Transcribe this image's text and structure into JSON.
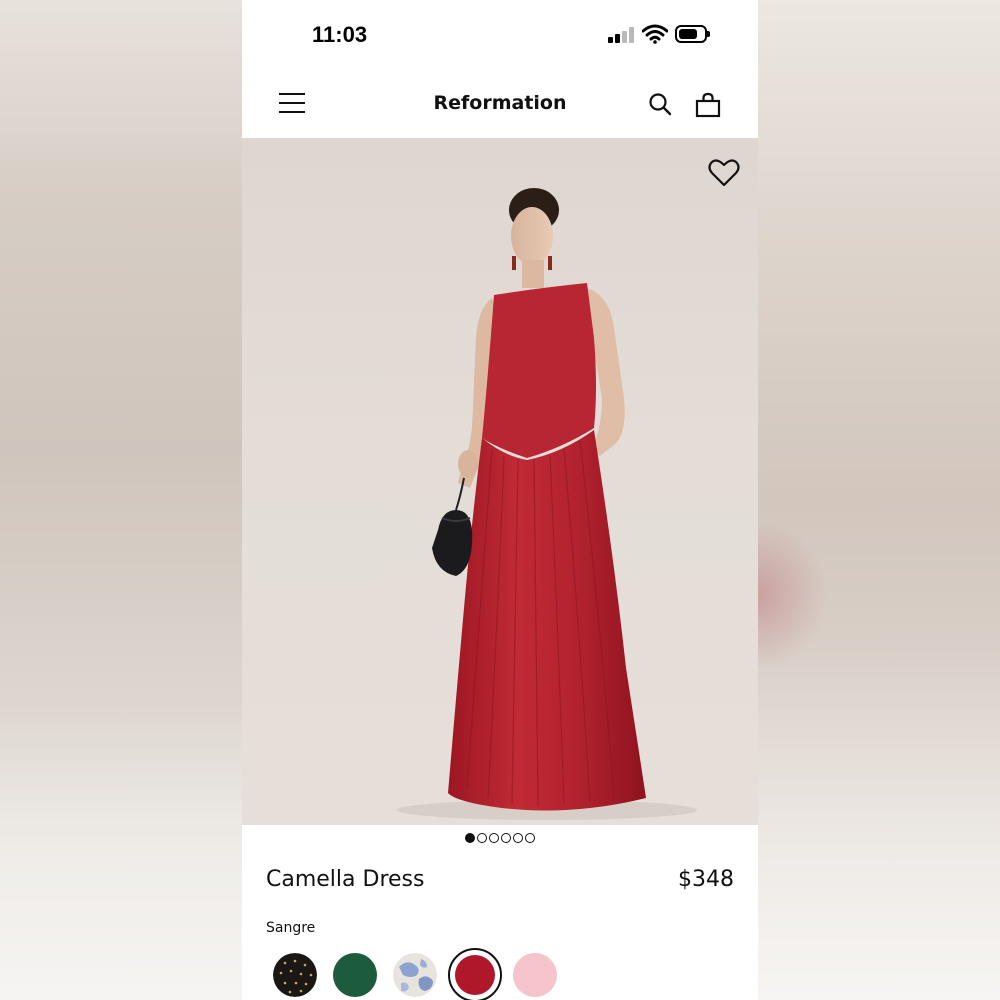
{
  "status_bar": {
    "time": "11:03"
  },
  "header": {
    "brand": "Reformation",
    "icons": [
      "menu-icon",
      "search-icon",
      "bag-icon"
    ]
  },
  "product": {
    "name": "Camella Dress",
    "price": "$348",
    "image_count": 6,
    "active_image": 1,
    "selected_color": "Sangre",
    "colors": [
      {
        "name": "black-polka-dot",
        "hex": "#1a1714"
      },
      {
        "name": "green",
        "hex": "#1d5b3d"
      },
      {
        "name": "blue-floral",
        "hex": "#9fb0d2"
      },
      {
        "name": "sangre",
        "hex": "#b1172b"
      },
      {
        "name": "pink",
        "hex": "#f6c4cc"
      }
    ]
  },
  "colors": {
    "dress": "#b3222f",
    "text": "#111111",
    "background": "#ffffff"
  }
}
